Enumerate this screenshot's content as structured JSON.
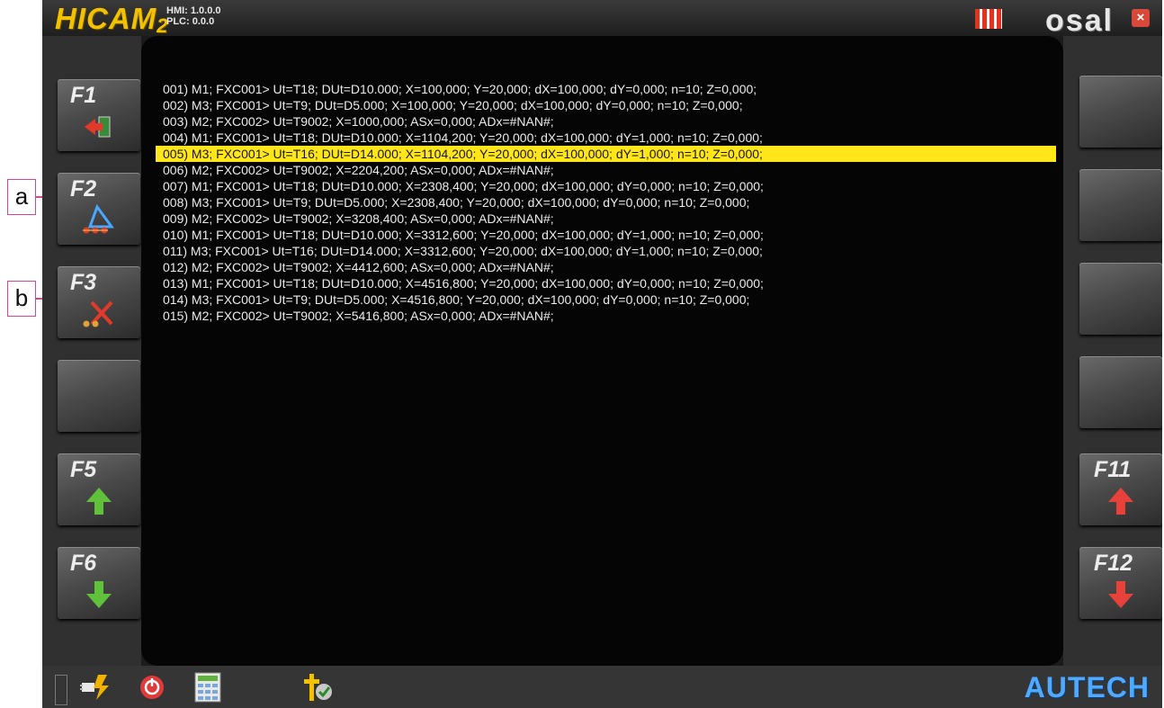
{
  "header": {
    "brand": "HICAM",
    "brand_sub": "2",
    "hmi_version": "HMI: 1.0.0.0",
    "plc_version": "PLC: 0.0.0",
    "vendor_logo": "osal",
    "close_label": "×"
  },
  "left_keys": [
    {
      "label": "F1",
      "icon": "exit-arrow-icon"
    },
    {
      "label": "F2",
      "icon": "triangle-tool-icon"
    },
    {
      "label": "F3",
      "icon": "delete-tool-icon"
    },
    {
      "label": "",
      "icon": ""
    },
    {
      "label": "F5",
      "icon": "arrow-up-icon"
    },
    {
      "label": "F6",
      "icon": "arrow-down-icon"
    }
  ],
  "right_keys": [
    {
      "label": "",
      "icon": ""
    },
    {
      "label": "",
      "icon": ""
    },
    {
      "label": "",
      "icon": ""
    },
    {
      "label": "",
      "icon": ""
    },
    {
      "label": "F11",
      "icon": "arrow-up-icon"
    },
    {
      "label": "F12",
      "icon": "arrow-down-icon"
    }
  ],
  "callouts": [
    "a",
    "b"
  ],
  "program": {
    "selected_index": 4,
    "lines": [
      "001) M1; FXC001> Ut=T18; DUt=D10.000; X=100,000; Y=20,000; dX=100,000; dY=0,000; n=10; Z=0,000;",
      "002) M3; FXC001> Ut=T9; DUt=D5.000; X=100,000; Y=20,000; dX=100,000; dY=0,000; n=10; Z=0,000;",
      "003) M2; FXC002> Ut=T9002; X=1000,000; ASx=0,000; ADx=#NAN#;",
      "004) M1; FXC001> Ut=T18; DUt=D10.000; X=1104,200; Y=20,000; dX=100,000; dY=1,000; n=10; Z=0,000;",
      "005) M3; FXC001> Ut=T16; DUt=D14.000; X=1104,200; Y=20,000; dX=100,000; dY=1,000; n=10; Z=0,000;",
      "006) M2; FXC002> Ut=T9002; X=2204,200; ASx=0,000; ADx=#NAN#;",
      "007) M1; FXC001> Ut=T18; DUt=D10.000; X=2308,400; Y=20,000; dX=100,000; dY=0,000; n=10; Z=0,000;",
      "008) M3; FXC001> Ut=T9; DUt=D5.000; X=2308,400; Y=20,000; dX=100,000; dY=0,000; n=10; Z=0,000;",
      "009) M2; FXC002> Ut=T9002; X=3208,400; ASx=0,000; ADx=#NAN#;",
      "010) M1; FXC001> Ut=T18; DUt=D10.000; X=3312,600; Y=20,000; dX=100,000; dY=1,000; n=10; Z=0,000;",
      "011) M3; FXC001> Ut=T16; DUt=D14.000; X=3312,600; Y=20,000; dX=100,000; dY=1,000; n=10; Z=0,000;",
      "012) M2; FXC002> Ut=T9002; X=4412,600; ASx=0,000; ADx=#NAN#;",
      "013) M1; FXC001> Ut=T18; DUt=D10.000; X=4516,800; Y=20,000; dX=100,000; dY=0,000; n=10; Z=0,000;",
      "014) M3; FXC001> Ut=T9; DUt=D5.000; X=4516,800; Y=20,000; dX=100,000; dY=0,000; n=10; Z=0,000;",
      "015) M2; FXC002> Ut=T9002; X=5416,800; ASx=0,000; ADx=#NAN#;"
    ]
  },
  "statusbar": {
    "icons": [
      "power-plug-icon",
      "stop-icon",
      "calculator-icon",
      "tool-check-icon"
    ],
    "brand": "AUTECH"
  },
  "colors": {
    "accent_yellow": "#f2c200",
    "selection": "#ffe61a",
    "autech_blue": "#4fa9ff"
  }
}
